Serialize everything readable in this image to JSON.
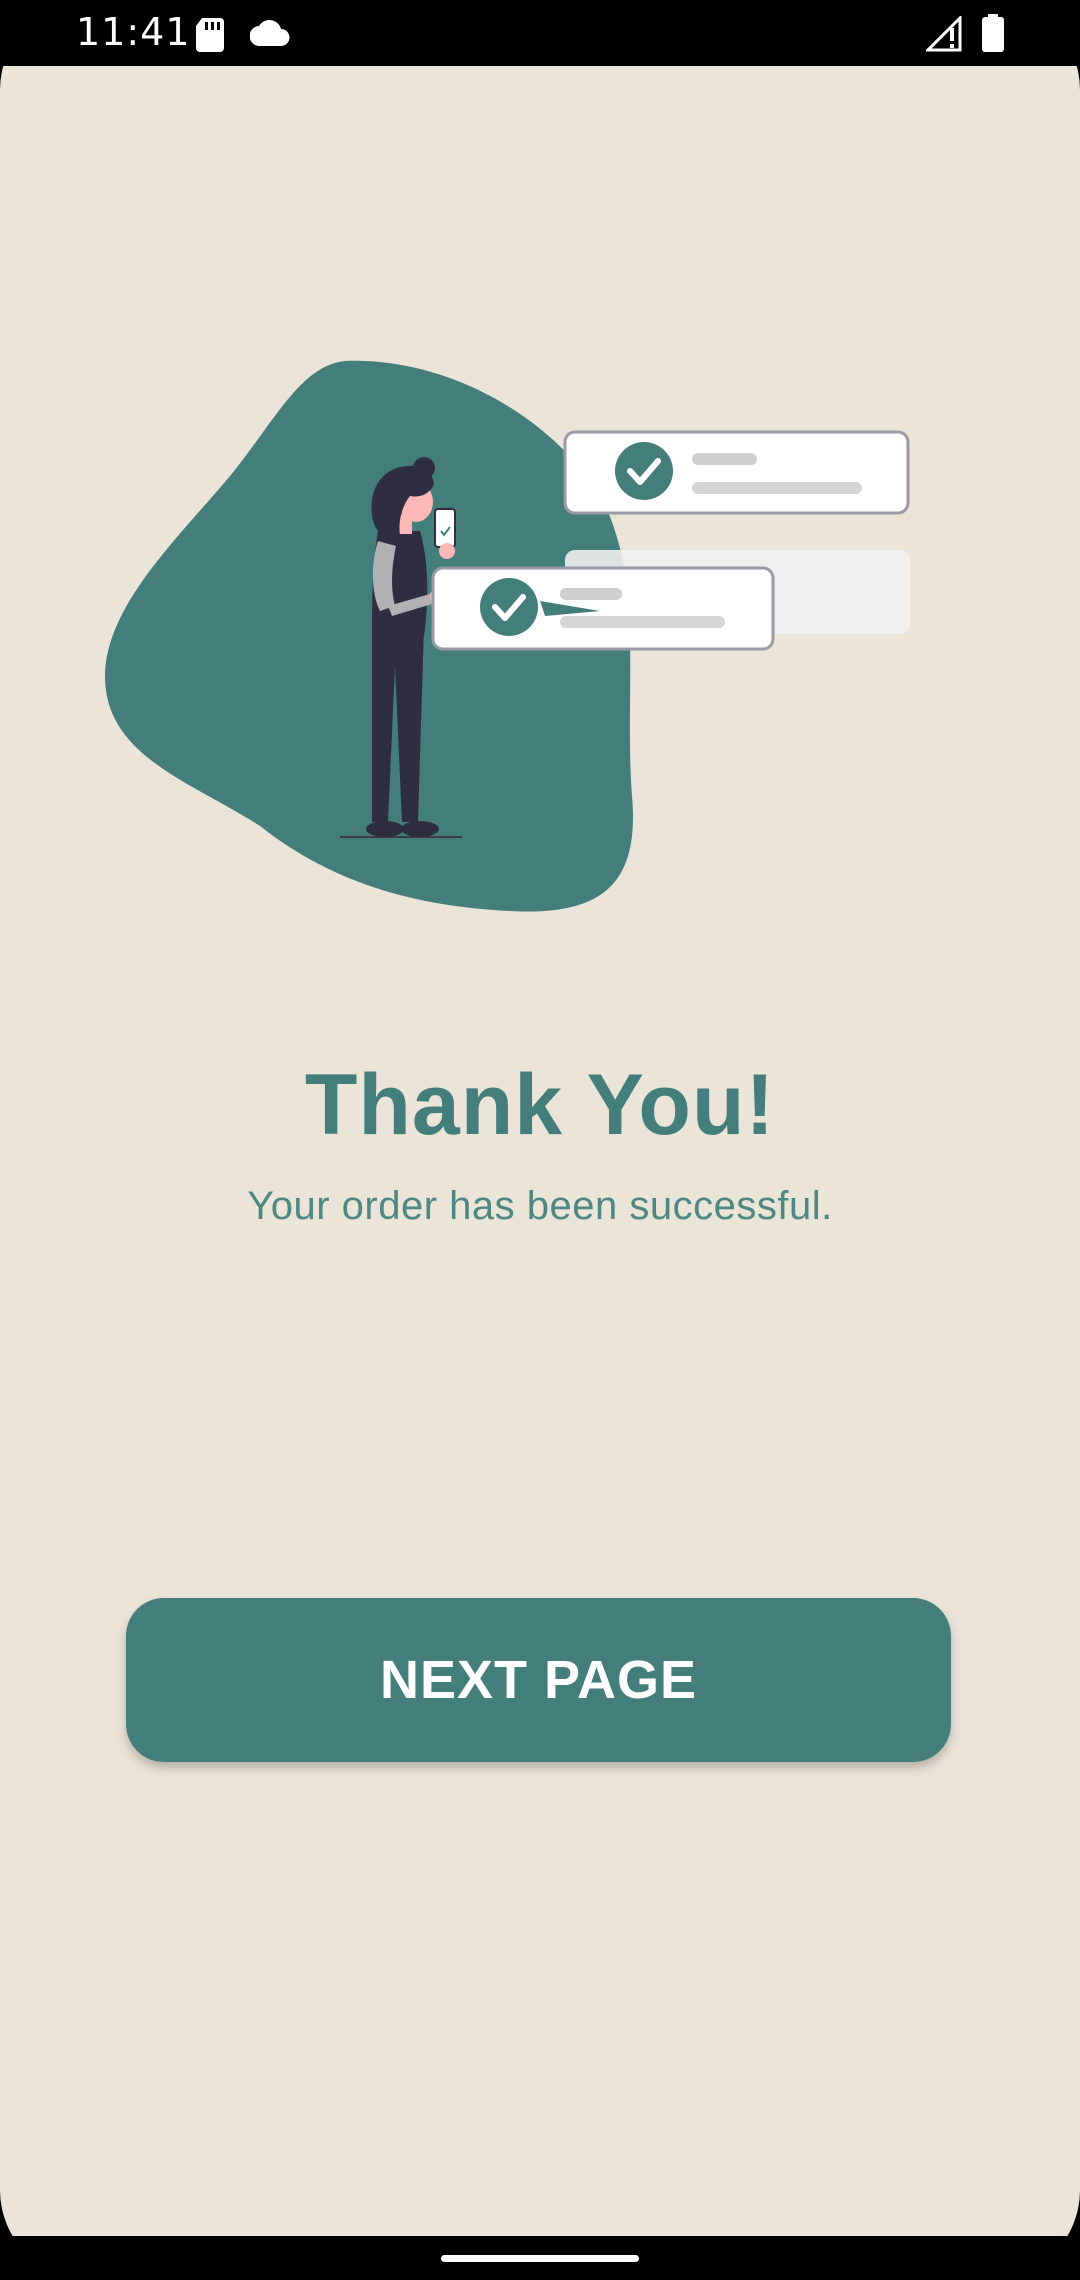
{
  "status_bar": {
    "time": "11:41",
    "icons": [
      "sd-card-icon",
      "cloud-icon",
      "signal-warning-icon",
      "battery-icon"
    ]
  },
  "illustration": {
    "name": "order-success-illustration",
    "colors": {
      "blob": "#437e7a",
      "card_border": "#9a9aa6",
      "check": "#437e7a",
      "figure": "#2f2e41",
      "skin": "#ffb8b8"
    }
  },
  "main": {
    "title": "Thank You!",
    "subtitle": "Your order has been successful."
  },
  "actions": {
    "next_label": "NEXT PAGE"
  },
  "colors": {
    "background": "#ebe4d9",
    "accent": "#437e7a",
    "button_text": "#ffffff"
  }
}
